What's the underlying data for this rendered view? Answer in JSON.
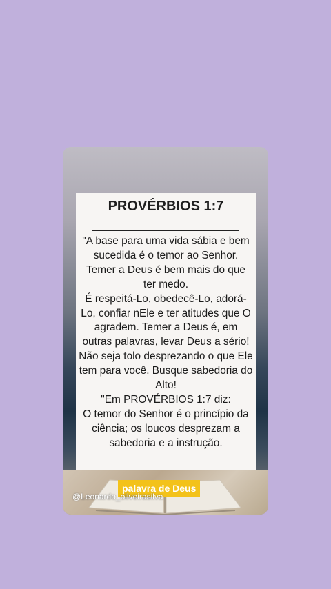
{
  "card": {
    "title": "PROVÉRBIOS 1:7",
    "body": "\"A base para uma vida sábia e bem sucedida é o temor ao Senhor. Temer a Deus é bem mais do que ter medo.\nÉ respeitá-Lo, obedecê-Lo, adorá-Lo, confiar nEle e ter atitudes que O agradem. Temer a Deus é, em outras palavras, levar Deus a sério! Não seja tolo desprezando o que Ele tem para você. Busque sabedoria do Alto!\n\"Em PROVÉRBIOS 1:7 diz:\nO temor do Senhor é o princípio da ciência; os loucos desprezam a sabedoria e a instrução.",
    "tag": "palavra de Deus",
    "handle": "@Leonardo_oliveirasilva"
  },
  "colors": {
    "background": "#c0b0dc",
    "tag": "#f3c21a"
  }
}
